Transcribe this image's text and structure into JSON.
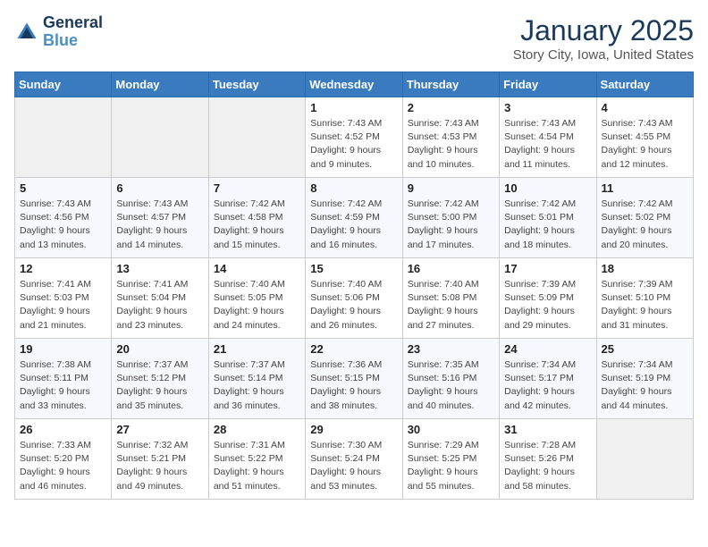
{
  "header": {
    "logo_line1": "General",
    "logo_line2": "Blue",
    "title": "January 2025",
    "subtitle": "Story City, Iowa, United States"
  },
  "weekdays": [
    "Sunday",
    "Monday",
    "Tuesday",
    "Wednesday",
    "Thursday",
    "Friday",
    "Saturday"
  ],
  "weeks": [
    [
      {
        "day": "",
        "info": ""
      },
      {
        "day": "",
        "info": ""
      },
      {
        "day": "",
        "info": ""
      },
      {
        "day": "1",
        "info": "Sunrise: 7:43 AM\nSunset: 4:52 PM\nDaylight: 9 hours\nand 9 minutes."
      },
      {
        "day": "2",
        "info": "Sunrise: 7:43 AM\nSunset: 4:53 PM\nDaylight: 9 hours\nand 10 minutes."
      },
      {
        "day": "3",
        "info": "Sunrise: 7:43 AM\nSunset: 4:54 PM\nDaylight: 9 hours\nand 11 minutes."
      },
      {
        "day": "4",
        "info": "Sunrise: 7:43 AM\nSunset: 4:55 PM\nDaylight: 9 hours\nand 12 minutes."
      }
    ],
    [
      {
        "day": "5",
        "info": "Sunrise: 7:43 AM\nSunset: 4:56 PM\nDaylight: 9 hours\nand 13 minutes."
      },
      {
        "day": "6",
        "info": "Sunrise: 7:43 AM\nSunset: 4:57 PM\nDaylight: 9 hours\nand 14 minutes."
      },
      {
        "day": "7",
        "info": "Sunrise: 7:42 AM\nSunset: 4:58 PM\nDaylight: 9 hours\nand 15 minutes."
      },
      {
        "day": "8",
        "info": "Sunrise: 7:42 AM\nSunset: 4:59 PM\nDaylight: 9 hours\nand 16 minutes."
      },
      {
        "day": "9",
        "info": "Sunrise: 7:42 AM\nSunset: 5:00 PM\nDaylight: 9 hours\nand 17 minutes."
      },
      {
        "day": "10",
        "info": "Sunrise: 7:42 AM\nSunset: 5:01 PM\nDaylight: 9 hours\nand 18 minutes."
      },
      {
        "day": "11",
        "info": "Sunrise: 7:42 AM\nSunset: 5:02 PM\nDaylight: 9 hours\nand 20 minutes."
      }
    ],
    [
      {
        "day": "12",
        "info": "Sunrise: 7:41 AM\nSunset: 5:03 PM\nDaylight: 9 hours\nand 21 minutes."
      },
      {
        "day": "13",
        "info": "Sunrise: 7:41 AM\nSunset: 5:04 PM\nDaylight: 9 hours\nand 23 minutes."
      },
      {
        "day": "14",
        "info": "Sunrise: 7:40 AM\nSunset: 5:05 PM\nDaylight: 9 hours\nand 24 minutes."
      },
      {
        "day": "15",
        "info": "Sunrise: 7:40 AM\nSunset: 5:06 PM\nDaylight: 9 hours\nand 26 minutes."
      },
      {
        "day": "16",
        "info": "Sunrise: 7:40 AM\nSunset: 5:08 PM\nDaylight: 9 hours\nand 27 minutes."
      },
      {
        "day": "17",
        "info": "Sunrise: 7:39 AM\nSunset: 5:09 PM\nDaylight: 9 hours\nand 29 minutes."
      },
      {
        "day": "18",
        "info": "Sunrise: 7:39 AM\nSunset: 5:10 PM\nDaylight: 9 hours\nand 31 minutes."
      }
    ],
    [
      {
        "day": "19",
        "info": "Sunrise: 7:38 AM\nSunset: 5:11 PM\nDaylight: 9 hours\nand 33 minutes."
      },
      {
        "day": "20",
        "info": "Sunrise: 7:37 AM\nSunset: 5:12 PM\nDaylight: 9 hours\nand 35 minutes."
      },
      {
        "day": "21",
        "info": "Sunrise: 7:37 AM\nSunset: 5:14 PM\nDaylight: 9 hours\nand 36 minutes."
      },
      {
        "day": "22",
        "info": "Sunrise: 7:36 AM\nSunset: 5:15 PM\nDaylight: 9 hours\nand 38 minutes."
      },
      {
        "day": "23",
        "info": "Sunrise: 7:35 AM\nSunset: 5:16 PM\nDaylight: 9 hours\nand 40 minutes."
      },
      {
        "day": "24",
        "info": "Sunrise: 7:34 AM\nSunset: 5:17 PM\nDaylight: 9 hours\nand 42 minutes."
      },
      {
        "day": "25",
        "info": "Sunrise: 7:34 AM\nSunset: 5:19 PM\nDaylight: 9 hours\nand 44 minutes."
      }
    ],
    [
      {
        "day": "26",
        "info": "Sunrise: 7:33 AM\nSunset: 5:20 PM\nDaylight: 9 hours\nand 46 minutes."
      },
      {
        "day": "27",
        "info": "Sunrise: 7:32 AM\nSunset: 5:21 PM\nDaylight: 9 hours\nand 49 minutes."
      },
      {
        "day": "28",
        "info": "Sunrise: 7:31 AM\nSunset: 5:22 PM\nDaylight: 9 hours\nand 51 minutes."
      },
      {
        "day": "29",
        "info": "Sunrise: 7:30 AM\nSunset: 5:24 PM\nDaylight: 9 hours\nand 53 minutes."
      },
      {
        "day": "30",
        "info": "Sunrise: 7:29 AM\nSunset: 5:25 PM\nDaylight: 9 hours\nand 55 minutes."
      },
      {
        "day": "31",
        "info": "Sunrise: 7:28 AM\nSunset: 5:26 PM\nDaylight: 9 hours\nand 58 minutes."
      },
      {
        "day": "",
        "info": ""
      }
    ]
  ]
}
